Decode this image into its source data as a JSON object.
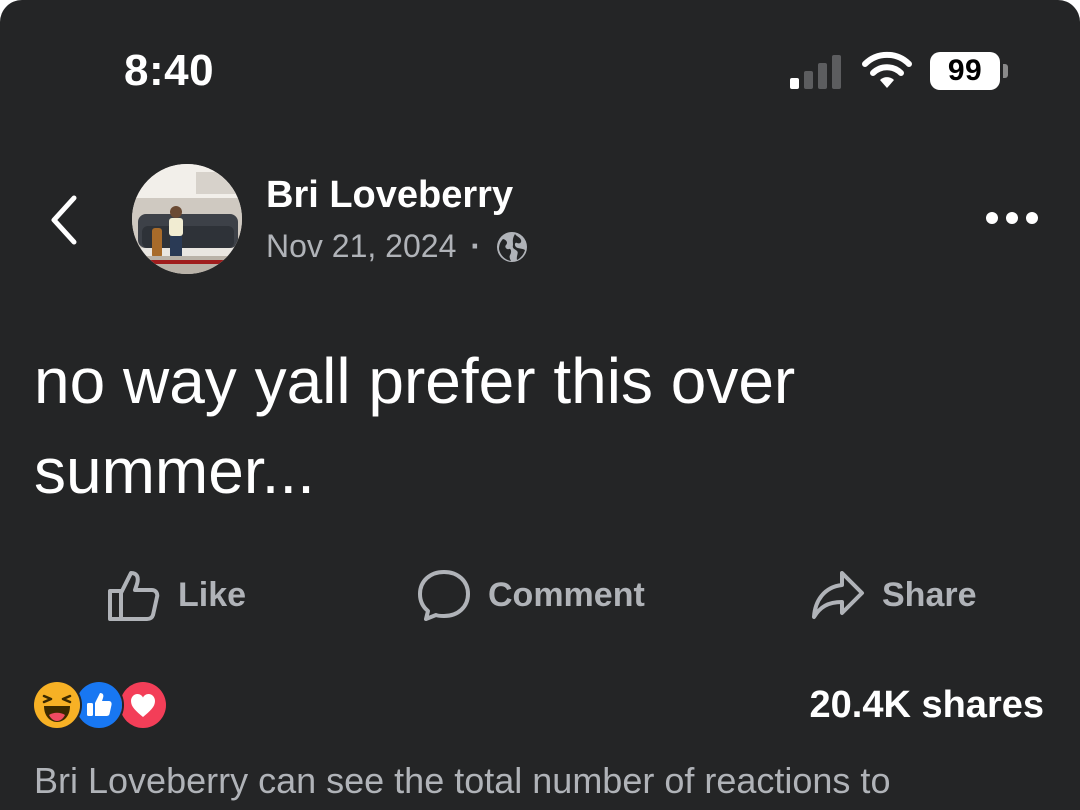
{
  "status_bar": {
    "time": "8:40",
    "battery": "99",
    "signal_icon": "cellular-signal-icon",
    "wifi_icon": "wifi-icon"
  },
  "header": {
    "back_icon": "chevron-left-icon",
    "author": "Bri Loveberry",
    "date": "Nov 21, 2024",
    "separator": "·",
    "privacy_icon": "globe-icon",
    "more_icon": "more-horizontal-icon"
  },
  "post": {
    "text": "no way yall prefer this over summer..."
  },
  "actions": {
    "like_label": "Like",
    "comment_label": "Comment",
    "share_label": "Share"
  },
  "stats": {
    "reactions": [
      "haha",
      "like",
      "love"
    ],
    "shares": "20.4K shares",
    "note": "Bri Loveberry can see the total number of reactions to"
  },
  "colors": {
    "background": "#242526",
    "text_primary": "#ffffff",
    "text_secondary": "#b0b3b8",
    "like_blue": "#1877f2",
    "love_red": "#f33e58",
    "haha_yellow": "#f7b125"
  }
}
